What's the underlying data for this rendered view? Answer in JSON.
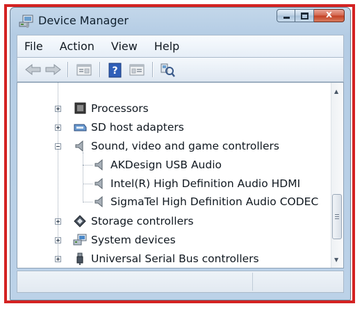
{
  "window": {
    "title": "Device Manager",
    "close_glyph": "x",
    "icon": "computer-icon"
  },
  "menu": [
    "File",
    "Action",
    "View",
    "Help"
  ],
  "toolbar": {
    "icons": [
      "back-arrow-icon",
      "forward-arrow-icon",
      "properties-icon",
      "help-icon",
      "view-icon",
      "scan-hardware-icon"
    ],
    "help_glyph": "?"
  },
  "tree": {
    "items": [
      {
        "label": "Processors",
        "icon": "processor-icon",
        "expanded": false
      },
      {
        "label": "SD host adapters",
        "icon": "sd-card-icon",
        "expanded": false
      },
      {
        "label": "Sound, video and game controllers",
        "icon": "speaker-icon",
        "expanded": true
      },
      {
        "label": "AKDesign USB Audio",
        "icon": "speaker-icon",
        "child": true
      },
      {
        "label": "Intel(R) High Definition Audio HDMI",
        "icon": "speaker-icon",
        "child": true
      },
      {
        "label": "SigmaTel High Definition Audio CODEC",
        "icon": "speaker-icon",
        "child": true
      },
      {
        "label": "Storage controllers",
        "icon": "storage-icon",
        "expanded": false
      },
      {
        "label": "System devices",
        "icon": "system-icon",
        "expanded": false
      },
      {
        "label": "Universal Serial Bus controllers",
        "icon": "usb-icon",
        "expanded": false
      }
    ]
  },
  "scrollbar": {
    "up_glyph": "▲",
    "down_glyph": "▼"
  },
  "colors": {
    "frame": "#d42222",
    "close": "#c23f22",
    "titlebar": "#bcd2e8"
  }
}
